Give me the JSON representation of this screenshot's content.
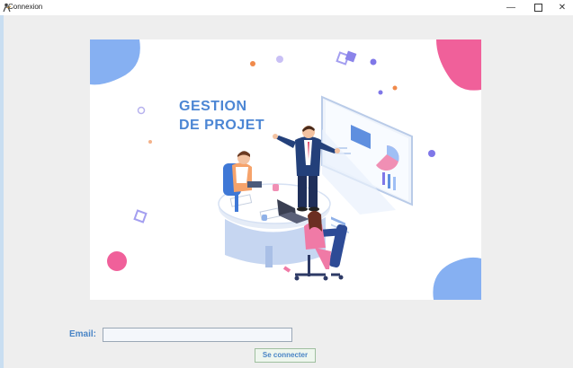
{
  "window": {
    "title": "Connexion",
    "controls": {
      "minimize": "—",
      "close": "✕"
    }
  },
  "banner": {
    "heading_line1": "GESTION",
    "heading_line2": "DE PROJET",
    "illustration": "team-meeting-illustration",
    "colors": {
      "heading": "#4c86d4",
      "pink": "#f0609a",
      "blue": "#7aa7f0",
      "purple": "#7f77e8",
      "orange": "#f08a4b"
    }
  },
  "form": {
    "email_label": "Email:",
    "email_value": "",
    "submit_label": "Se connecter"
  }
}
